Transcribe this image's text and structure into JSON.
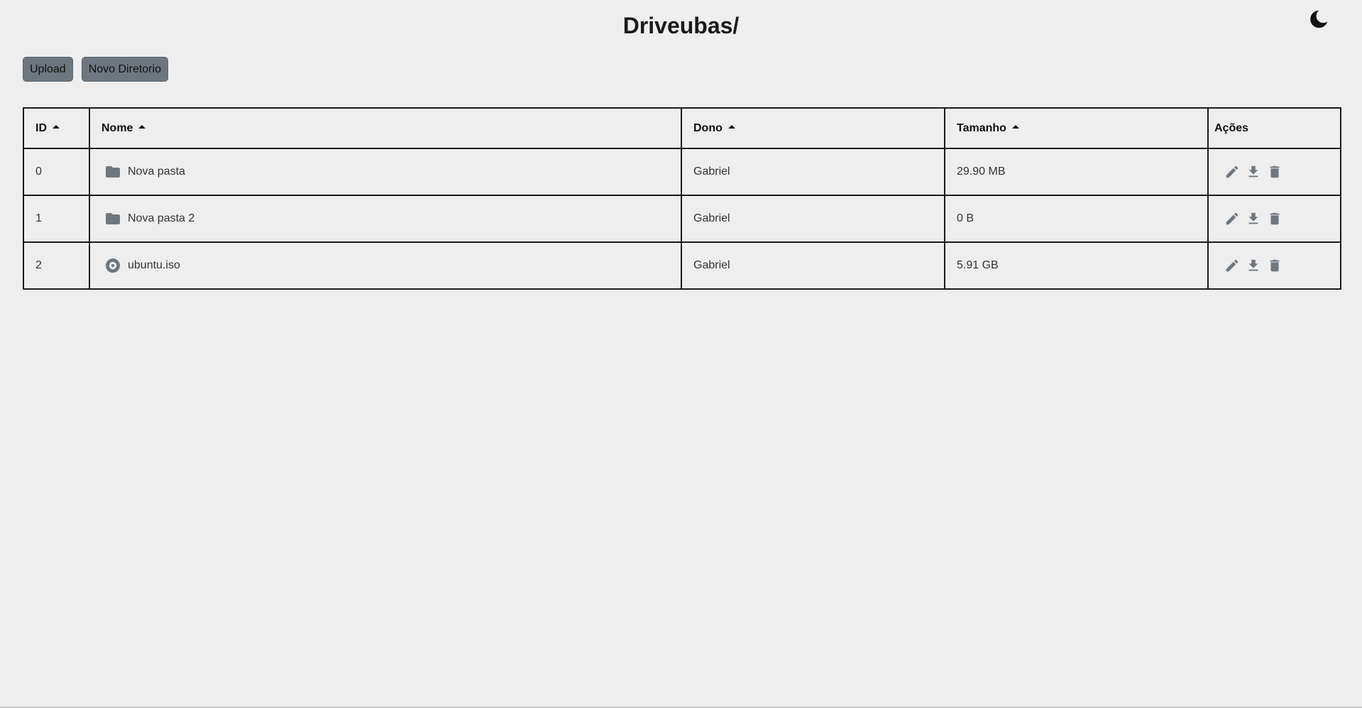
{
  "header": {
    "title": "Driveubas/",
    "theme_icon": "moon-icon"
  },
  "toolbar": {
    "upload_label": "Upload",
    "new_dir_label": "Novo Diretorio"
  },
  "table": {
    "columns": {
      "id": "ID",
      "name": "Nome",
      "owner": "Dono",
      "size": "Tamanho",
      "actions": "Ações"
    },
    "rows": [
      {
        "id": "0",
        "name": "Nova pasta",
        "type_icon": "folder-icon",
        "owner": "Gabriel",
        "size": "29.90 MB"
      },
      {
        "id": "1",
        "name": "Nova pasta 2",
        "type_icon": "folder-icon",
        "owner": "Gabriel",
        "size": "0 B"
      },
      {
        "id": "2",
        "name": "ubuntu.iso",
        "type_icon": "disc-icon",
        "owner": "Gabriel",
        "size": "5.91 GB"
      }
    ],
    "action_icons": [
      "edit-icon",
      "download-icon",
      "delete-icon"
    ]
  },
  "colors": {
    "background": "#eeeeee",
    "button": "#6e7780",
    "icon": "#6e7780",
    "text": "#1a1a1a"
  }
}
